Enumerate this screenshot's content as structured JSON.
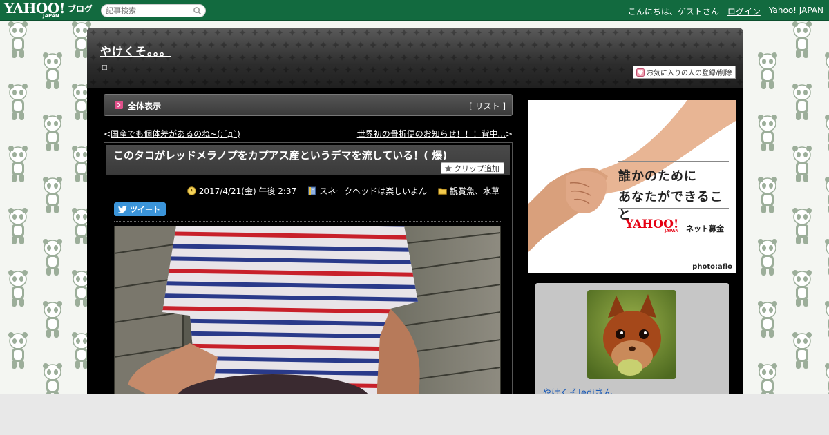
{
  "topbar": {
    "logo": "YAHOO!",
    "logo_sub": "JAPAN",
    "logo_blog": "ブログ",
    "search_placeholder": "記事検索",
    "greeting": "こんにちは、ゲストさん",
    "login": "ログイン",
    "yahoo_japan": "Yahoo! JAPAN"
  },
  "blog": {
    "title": "やけくそ。。。",
    "description": "□",
    "favorite_button": "お気に入りの人の登録/削除"
  },
  "allview": {
    "title": "全体表示",
    "list_open": "[ ",
    "list_link": "リスト",
    "list_close": " ]"
  },
  "nav": {
    "prev_arrow": "<",
    "prev_title": "国産でも個体差があるのね~(;´д`)",
    "next_title": "世界初の骨折便のお知らせ！！！背中...",
    "next_arrow": ">"
  },
  "article": {
    "title": "このタコがレッドメラノプをカプアス産というデマを流している！( 爆)",
    "clip_label": "クリップ追加",
    "date": "2017/4/21(金) 午後 2:37",
    "category": "スネークヘッドは楽しいよん",
    "folder": "観賞魚、水草",
    "tweet_label": "ツイート"
  },
  "ad": {
    "line1": "誰かのために",
    "line2": "あなたができること",
    "logo": "YAHOO!",
    "logo_sub": "JAPAN",
    "service": "ネット募金",
    "credit": "photo:aflo"
  },
  "profile": {
    "name": "やけくそJediさん"
  }
}
